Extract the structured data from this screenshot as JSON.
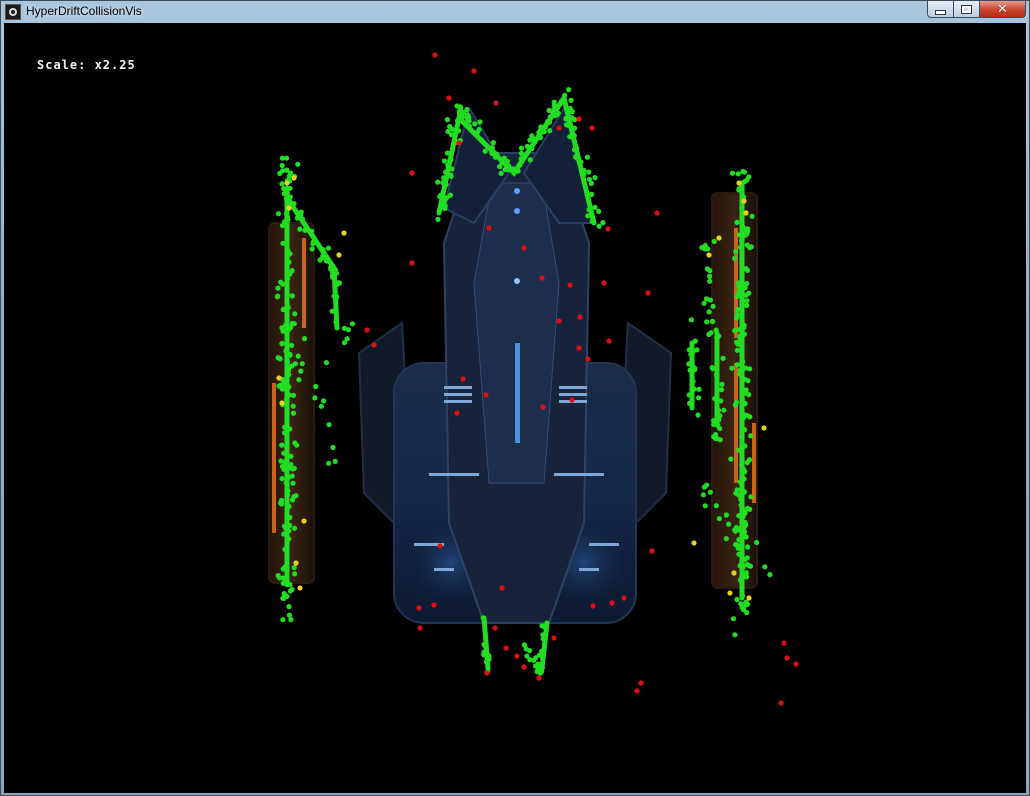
{
  "window": {
    "title": "HyperDriftCollisionVis",
    "icon": "app-icon"
  },
  "hud": {
    "scale_text": "Scale: x2.25"
  },
  "colors": {
    "background": "#000000",
    "point_green": "#22dd22",
    "point_yellow": "#e6d21c",
    "point_red": "#e01010",
    "ship_blue": "#1c3a66",
    "thruster_orange": "#c8641e"
  }
}
